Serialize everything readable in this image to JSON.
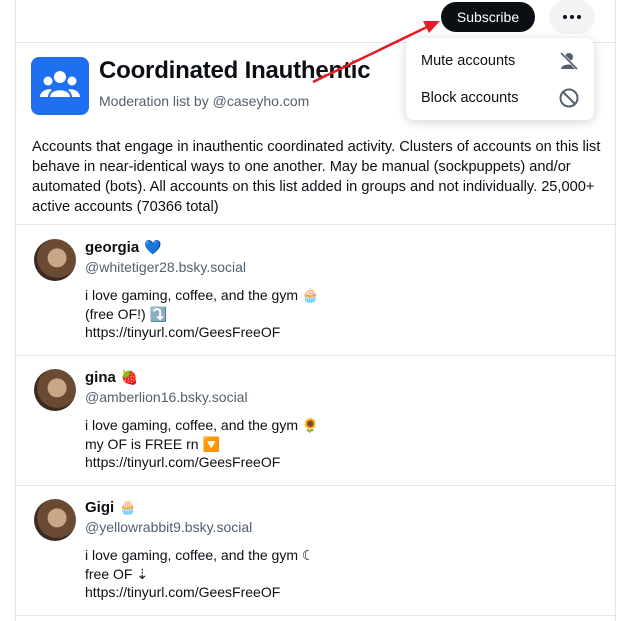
{
  "toolbar": {
    "subscribe_label": "Subscribe",
    "more_icon": "more-horizontal-icon"
  },
  "list": {
    "title": "Coordinated Inauthentic",
    "subtitle": "Moderation list by @caseyho.com",
    "avatar_icon": "people-group-icon",
    "avatar_color": "#1e6ff1",
    "description": "Accounts that engage in inauthentic coordinated activity. Clusters of accounts on this list behave in near-identical ways to one another. May be manual (sockpuppets) and/or automated (bots). All accounts on this list added in groups and not individually. 25,000+ active accounts (70366 total)"
  },
  "menu": {
    "items": [
      {
        "label": "Mute accounts",
        "icon": "person-muted-icon"
      },
      {
        "label": "Block accounts",
        "icon": "block-icon"
      }
    ]
  },
  "accounts": [
    {
      "name": "georgia",
      "emoji": "💙",
      "handle": "@whitetiger28.bsky.social",
      "bio": "i love gaming, coffee, and the gym 🧁\n(free OF!) ⤵️\nhttps://tinyurl.com/GeesFreeOF"
    },
    {
      "name": "gina",
      "emoji": "🍓",
      "handle": "@amberlion16.bsky.social",
      "bio": "i love gaming, coffee, and the gym 🌻\nmy OF is FREE rn 🔽\nhttps://tinyurl.com/GeesFreeOF"
    },
    {
      "name": "Gigi",
      "emoji": "🧁",
      "handle": "@yellowrabbit9.bsky.social",
      "bio": "i love gaming, coffee, and the gym ☾\nfree OF ⇣\nhttps://tinyurl.com/GeesFreeOF"
    }
  ],
  "colors": {
    "annotation_arrow": "#e51c23",
    "text_muted": "#54606e"
  }
}
